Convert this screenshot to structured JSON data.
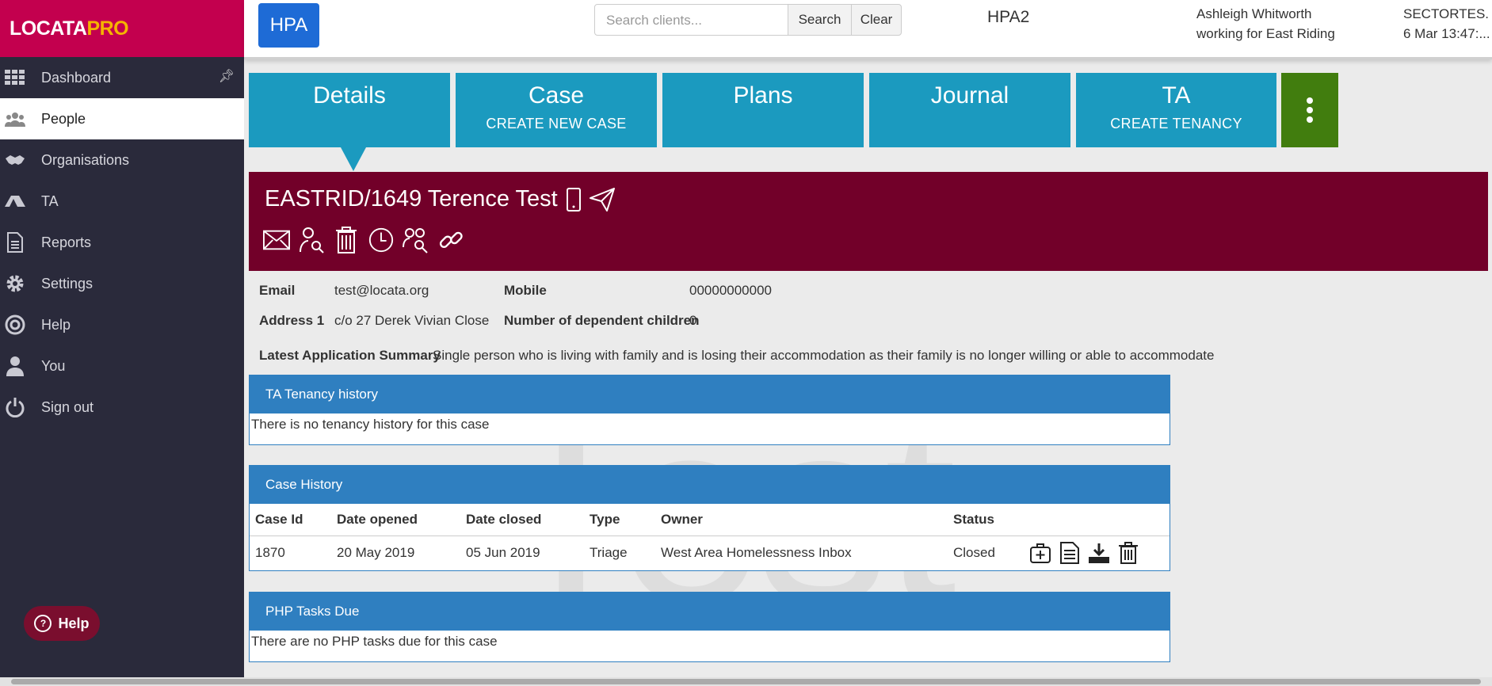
{
  "logo": {
    "main": "LOCATA",
    "accent": "PRO"
  },
  "sidebar": {
    "items": [
      {
        "label": "Dashboard",
        "icon": "grid-icon"
      },
      {
        "label": "People",
        "icon": "people-icon"
      },
      {
        "label": "Organisations",
        "icon": "handshake-icon"
      },
      {
        "label": "TA",
        "icon": "tent-icon"
      },
      {
        "label": "Reports",
        "icon": "report-icon"
      },
      {
        "label": "Settings",
        "icon": "gear-icon"
      },
      {
        "label": "Help",
        "icon": "lifebuoy-icon"
      },
      {
        "label": "You",
        "icon": "user-icon"
      },
      {
        "label": "Sign out",
        "icon": "power-icon"
      }
    ],
    "active": "People",
    "help_button": "Help"
  },
  "topbar": {
    "hpa_button": "HPA",
    "search": {
      "placeholder": "Search clients...",
      "search_label": "Search",
      "clear_label": "Clear"
    },
    "context": "HPA2",
    "user_name": "Ashleigh Whitworth",
    "user_org": "working for East Riding",
    "sector": "SECTORTES...",
    "datetime": "6 Mar 13:47:..."
  },
  "tabs": [
    {
      "title": "Details",
      "sub": ""
    },
    {
      "title": "Case",
      "sub": "CREATE NEW CASE"
    },
    {
      "title": "Plans",
      "sub": ""
    },
    {
      "title": "Journal",
      "sub": ""
    },
    {
      "title": "TA",
      "sub": "CREATE TENANCY"
    }
  ],
  "person": {
    "title": "EASTRID/1649 Terence Test"
  },
  "details": {
    "email_label": "Email",
    "email": "test@locata.org",
    "mobile_label": "Mobile",
    "mobile": "00000000000",
    "address_label": "Address 1",
    "address": "c/o 27 Derek Vivian Close",
    "children_label": "Number of dependent children",
    "children": "0",
    "summary_label": "Latest Application Summary",
    "summary": "Single person who is living with family and is losing their accommodation as their family is no longer willing or able to accommodate"
  },
  "ta_history": {
    "title": "TA Tenancy history",
    "empty": "There is no tenancy history for this case"
  },
  "case_history": {
    "title": "Case History",
    "columns": [
      "Case Id",
      "Date opened",
      "Date closed",
      "Type",
      "Owner",
      "Status"
    ],
    "rows": [
      {
        "id": "1870",
        "opened": "20 May 2019",
        "closed": "05 Jun 2019",
        "type": "Triage",
        "owner": "West Area Homelessness Inbox",
        "status": "Closed"
      }
    ]
  },
  "php_tasks": {
    "title": "PHP Tasks Due",
    "empty": "There are no PHP tasks due for this case"
  },
  "watermark": "Test",
  "colors": {
    "brand": "#c3004e",
    "tab": "#1b9abf",
    "banner": "#720029",
    "panel": "#2f7fc0",
    "more": "#417d0e"
  }
}
